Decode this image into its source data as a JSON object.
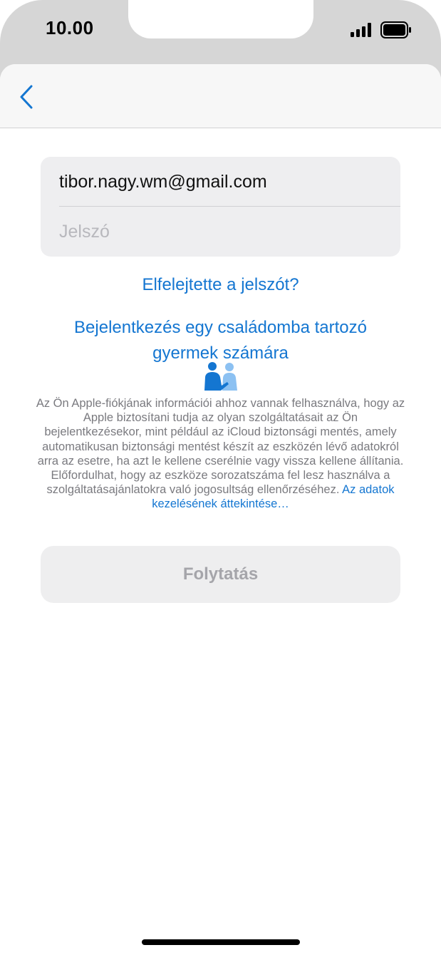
{
  "status_bar": {
    "time": "10.00"
  },
  "nav": {
    "back_icon": "chevron-left-icon"
  },
  "form": {
    "email_value": "tibor.nagy.wm@gmail.com",
    "password_placeholder": "Jelszó"
  },
  "links": {
    "forgot_password": "Elfelejtette a jelszót?",
    "family_line1": "Bejelentkezés egy családomba tartozó",
    "family_line2": "gyermek számára"
  },
  "icons": {
    "family": "family-sharing-icon"
  },
  "legal": {
    "text": "Az Ön Apple-fiókjának információi ahhoz vannak felhasználva, hogy az Apple biztosítani tudja az olyan szolgáltatásait az Ön bejelentkezésekor, mint például az iCloud biztonsági mentés, amely automatikusan biztonsági mentést készít az eszközén lévő adatokról arra az esetre, ha azt le kellene cserélnie vagy vissza kellene állítania. Előfordulhat, hogy az eszköze sorozatszáma fel lesz használva a szolgáltatásajánlatokra való jogosultság ellenőrzéséhez.",
    "more_link": "Az adatok kezelésének áttekintése…"
  },
  "buttons": {
    "continue": "Folytatás"
  },
  "colors": {
    "accent": "#1476d1",
    "disabled_text": "#a5a5aa",
    "field_bg": "#eeeef0"
  }
}
